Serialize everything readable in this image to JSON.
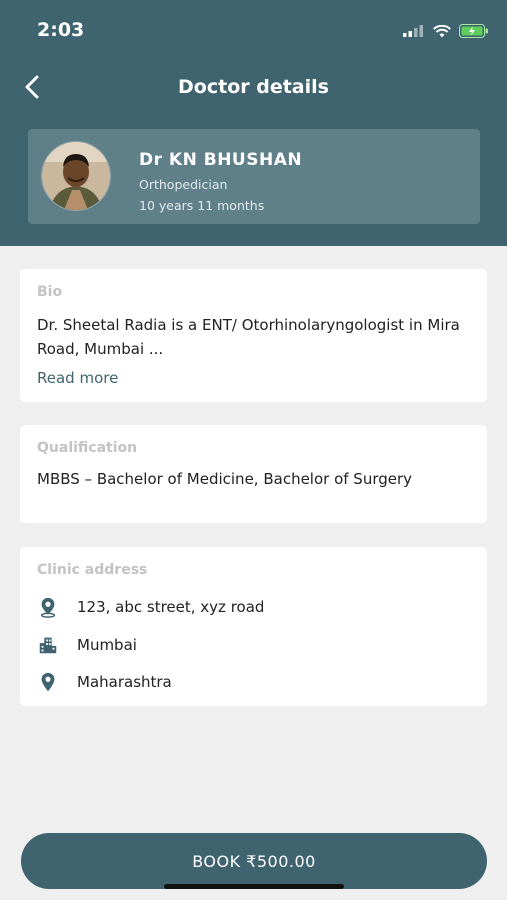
{
  "status_bar": {
    "time": "2:03"
  },
  "header": {
    "title": "Doctor details"
  },
  "doctor": {
    "name": "Dr KN BHUSHAN",
    "specialty": "Orthopedician",
    "experience": "10 years 11 months"
  },
  "bio": {
    "title": "Bio",
    "text": "Dr. Sheetal Radia is a ENT/ Otorhinolaryngologist in Mira Road, Mumbai ...",
    "read_more": "Read more"
  },
  "qualification": {
    "title": "Qualification",
    "text": "MBBS – Bachelor of Medicine, Bachelor of Surgery"
  },
  "clinic": {
    "title": "Clinic address",
    "street": "123, abc street, xyz road",
    "city": "Mumbai",
    "state": "Maharashtra"
  },
  "book_button": {
    "label": "BOOK ₹500.00"
  },
  "colors": {
    "primary": "#3f6470",
    "card": "#5f7f89",
    "background": "#efefef"
  },
  "icons": [
    "back-arrow-icon",
    "location-pin-icon",
    "city-icon",
    "map-marker-icon"
  ]
}
